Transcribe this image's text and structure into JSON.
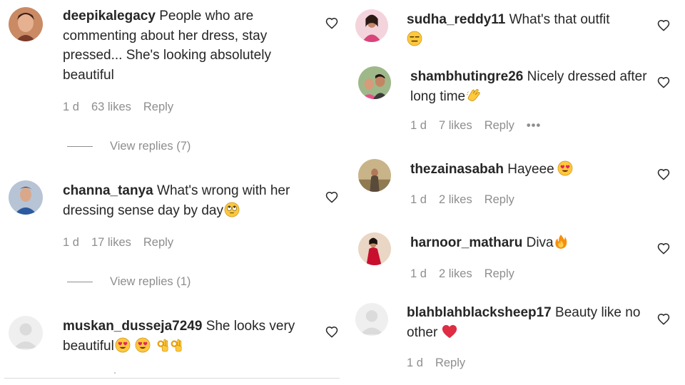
{
  "left_comments": [
    {
      "username": "deepikalegacy",
      "text": "People who are commenting about her dress, stay pressed... She's looking absolutely beautiful",
      "time": "1 d",
      "likes": "63 likes",
      "reply": "Reply",
      "view_replies": "View replies (7)"
    },
    {
      "username": "channa_tanya",
      "text": "What's wrong with her dressing sense day by day",
      "time": "1 d",
      "likes": "17 likes",
      "reply": "Reply",
      "view_replies": "View replies (1)"
    },
    {
      "username": "muskan_dusseja7249",
      "text": "She looks very beautiful"
    }
  ],
  "right_comments": [
    {
      "username": "sudha_reddy11",
      "text": "What's that outfit"
    },
    {
      "username": "shambhutingre26",
      "text": "Nicely dressed after long time",
      "time": "1 d",
      "likes": "7 likes",
      "reply": "Reply",
      "more": "•••"
    },
    {
      "username": "thezainasabah",
      "text": "Hayeee",
      "time": "1 d",
      "likes": "2 likes",
      "reply": "Reply"
    },
    {
      "username": "harnoor_matharu",
      "text": "Diva",
      "time": "1 d",
      "likes": "2 likes",
      "reply": "Reply"
    },
    {
      "username": "blahblahblacksheep17",
      "text": "Beauty like no other",
      "time": "1 d",
      "reply": "Reply"
    }
  ],
  "icons": {
    "like": "heart-outline-icon",
    "emojis": [
      "rolling-eyes-emoji",
      "heart-eyes-emoji",
      "ok-hand-emoji",
      "expressionless-emoji",
      "clapping-hands-emoji",
      "fire-emoji",
      "red-heart-emoji"
    ]
  },
  "colors": {
    "text": "#262626",
    "secondary": "#8e8e8e",
    "divider": "#dbdbdb",
    "emoji_yellow": "#ffc83d",
    "emoji_red": "#e0245e"
  }
}
